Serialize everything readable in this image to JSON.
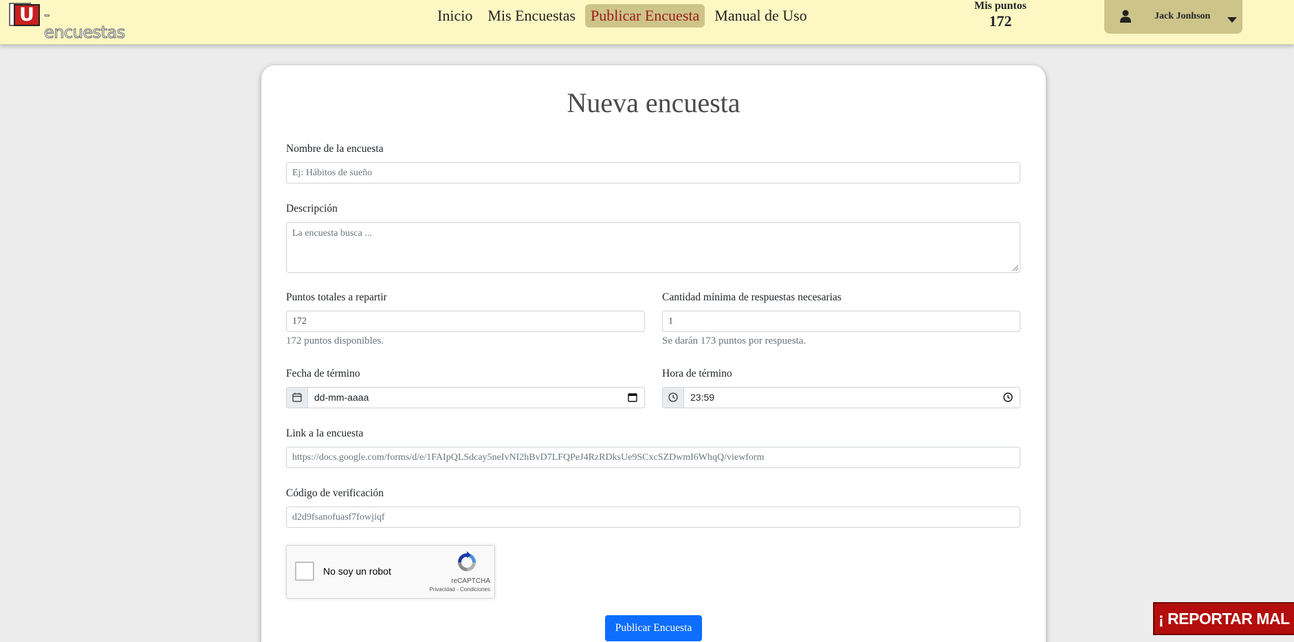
{
  "brand": {
    "logo_letter": "U",
    "logo_text": "-encuestas"
  },
  "nav": {
    "items": [
      {
        "label": "Inicio"
      },
      {
        "label": "Mis Encuestas"
      },
      {
        "label": "Publicar Encuesta",
        "active": true
      },
      {
        "label": "Manual de Uso"
      }
    ]
  },
  "points": {
    "label": "Mis puntos",
    "value": "172"
  },
  "user": {
    "name": "Jack Jonhson",
    "icon": "user-icon"
  },
  "form": {
    "title": "Nueva encuesta",
    "name": {
      "label": "Nombre de la encuesta",
      "placeholder": "Ej: Hábitos de sueño"
    },
    "description": {
      "label": "Descripción",
      "placeholder": "La encuesta busca ..."
    },
    "total_points": {
      "label": "Puntos totales a repartir",
      "value": "172",
      "help": "172 puntos disponibles."
    },
    "min_responses": {
      "label": "Cantidad mínima de respuestas necesarias",
      "value": "1",
      "help": "Se darán 173 puntos por respuesta."
    },
    "end_date": {
      "label": "Fecha de término",
      "value": "dd-mm-aaaa",
      "icon": "calendar-icon"
    },
    "end_time": {
      "label": "Hora de término",
      "value": "23:59",
      "icon": "clock-icon"
    },
    "link": {
      "label": "Link a la encuesta",
      "value": "https://docs.google.com/forms/d/e/1FAIpQLSdcay5neIvNI2hBvD7LFQPeJ4RzRDksUe9SCxcSZDwmI6WhqQ/viewform"
    },
    "verification": {
      "label": "Código de verificación",
      "value": "d2d9fsanofuasf7fowjiqf"
    },
    "captcha": {
      "label": "No soy un robot",
      "brand": "reCAPTCHA",
      "terms": "Privacidad - Condiciones"
    },
    "submit_label": "Publicar Encuesta"
  },
  "report_button": {
    "label": "¡ REPORTAR MAL USO !"
  },
  "colors": {
    "navbar": "#fdf8c3",
    "nav_active": "#cdc489",
    "nav_active_text": "#9b1b16",
    "primary": "#0d6efd",
    "report": "#b30d0d"
  }
}
